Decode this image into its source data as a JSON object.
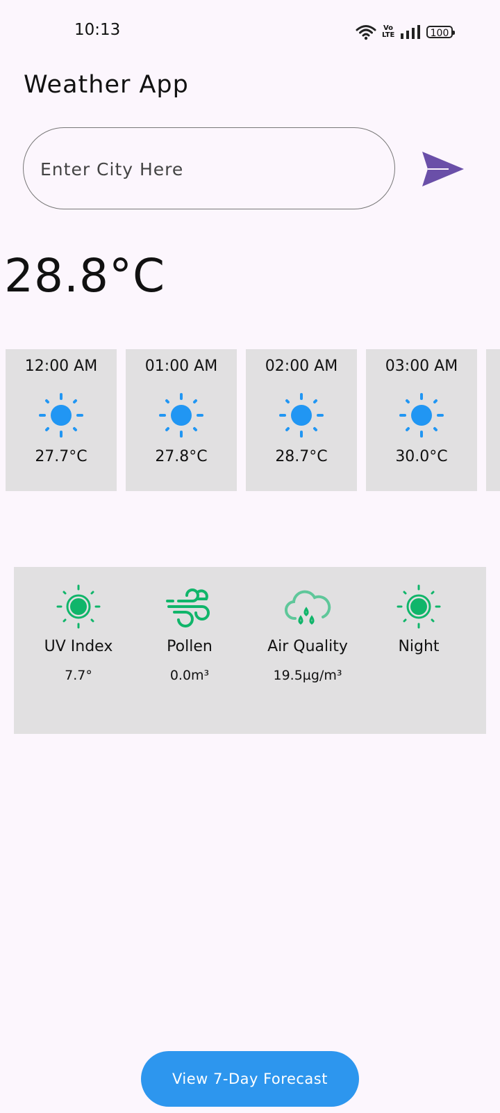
{
  "status_bar": {
    "time": "10:13",
    "network_label": "Vo LTE",
    "battery": "100",
    "icons": [
      "wifi-icon",
      "volte-icon",
      "signal-icon",
      "battery-icon"
    ]
  },
  "app": {
    "title": "Weather App"
  },
  "search": {
    "placeholder": "Enter City Here",
    "value": ""
  },
  "current": {
    "temperature": "28.8°C"
  },
  "hourly": [
    {
      "time": "12:00 AM",
      "temp": "27.7°C",
      "icon": "sun-icon"
    },
    {
      "time": "01:00 AM",
      "temp": "27.8°C",
      "icon": "sun-icon"
    },
    {
      "time": "02:00 AM",
      "temp": "28.7°C",
      "icon": "sun-icon"
    },
    {
      "time": "03:00 AM",
      "temp": "30.0°C",
      "icon": "sun-icon"
    }
  ],
  "details": [
    {
      "label": "UV Index",
      "value": "7.7°",
      "icon": "uv-sun-icon"
    },
    {
      "label": "Pollen",
      "value": "0.0m³",
      "icon": "wind-icon"
    },
    {
      "label": "Air Quality",
      "value": "19.5µg/m³",
      "icon": "cloud-drops-icon"
    },
    {
      "label": "Night",
      "value": "",
      "icon": "sun-icon"
    }
  ],
  "forecast_button": {
    "label": "View 7-Day Forecast"
  },
  "colors": {
    "background": "#fcf6fd",
    "card": "#e1e0e1",
    "accent_blue": "#2d96ee",
    "send_purple": "#6a4fa8",
    "green": "#10b56a"
  }
}
